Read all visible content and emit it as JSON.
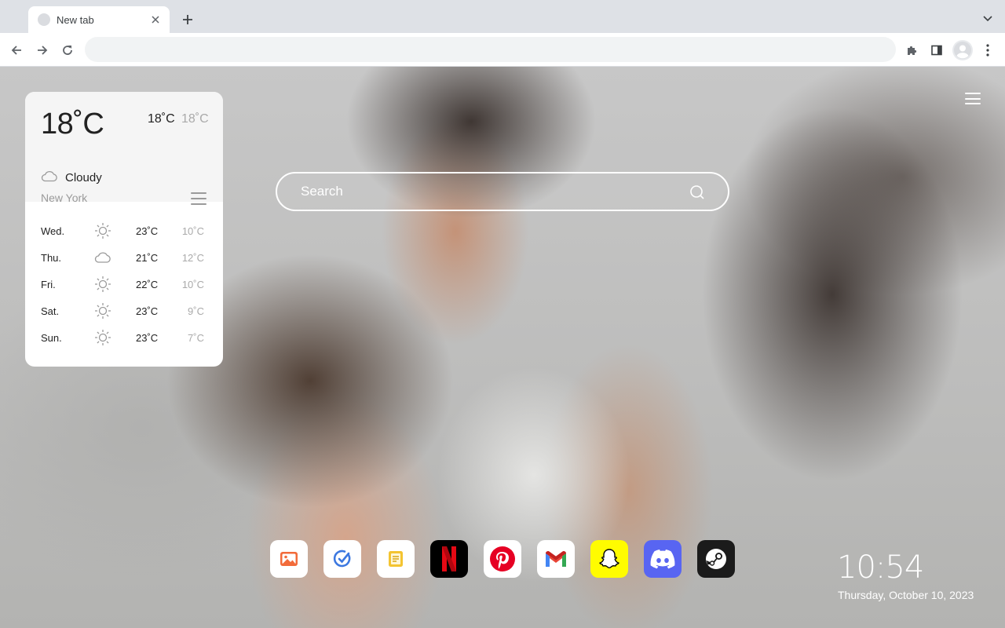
{
  "browser": {
    "tab_title": "New tab",
    "omnibox_value": "",
    "new_tab_symbol": "+"
  },
  "weather": {
    "current_temp": "18˚C",
    "high": "18˚C",
    "low": "18˚C",
    "condition": "Cloudy",
    "condition_icon": "cloud-icon",
    "city": "New York",
    "forecast": [
      {
        "day": "Wed.",
        "icon": "sun-icon",
        "high": "23˚C",
        "low": "10˚C"
      },
      {
        "day": "Thu.",
        "icon": "cloud-icon",
        "high": "21˚C",
        "low": "12˚C"
      },
      {
        "day": "Fri.",
        "icon": "sun-icon",
        "high": "22˚C",
        "low": "10˚C"
      },
      {
        "day": "Sat.",
        "icon": "sun-icon",
        "high": "23˚C",
        "low": "9˚C"
      },
      {
        "day": "Sun.",
        "icon": "sun-icon",
        "high": "23˚C",
        "low": "7˚C"
      }
    ]
  },
  "search": {
    "placeholder": "Search"
  },
  "shortcuts": [
    {
      "name": "photos",
      "icon": "photo-icon",
      "bg": "#ffffff"
    },
    {
      "name": "todo",
      "icon": "check-circle-icon",
      "bg": "#ffffff"
    },
    {
      "name": "notes",
      "icon": "notes-icon",
      "bg": "#ffffff"
    },
    {
      "name": "netflix",
      "icon": "netflix-icon",
      "bg": "#000000"
    },
    {
      "name": "pinterest",
      "icon": "pinterest-icon",
      "bg": "#ffffff"
    },
    {
      "name": "gmail",
      "icon": "gmail-icon",
      "bg": "#ffffff"
    },
    {
      "name": "snapchat",
      "icon": "snapchat-icon",
      "bg": "#fffc00"
    },
    {
      "name": "discord",
      "icon": "discord-icon",
      "bg": "#5865f2"
    },
    {
      "name": "steam",
      "icon": "steam-icon",
      "bg": "#1b1b1b"
    }
  ],
  "clock": {
    "time": "10:54",
    "date": "Thursday, October 10, 2023"
  },
  "colors": {
    "netflix_red": "#e50914",
    "pinterest_red": "#e60023",
    "discord_blurple": "#5865f2",
    "snapchat_yellow": "#fffc00",
    "notes_yellow": "#f4c431",
    "photos_orange": "#f26b3a",
    "todo_blue": "#3c78e0"
  }
}
